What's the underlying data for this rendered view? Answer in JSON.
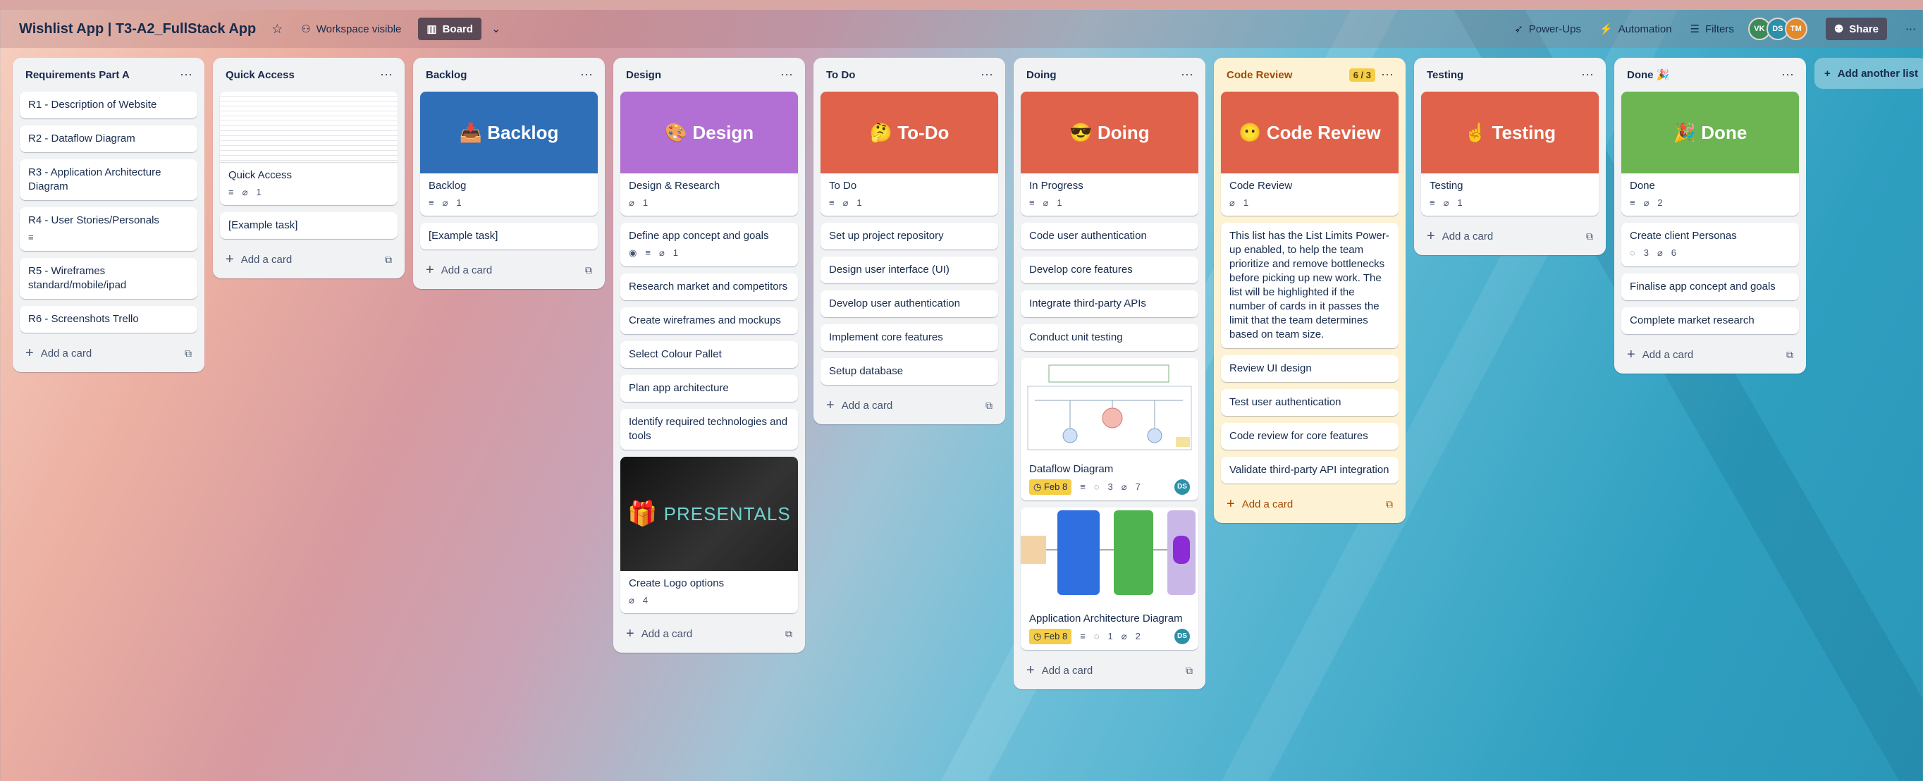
{
  "header": {
    "board_title": "Wishlist App | T3-A2_FullStack App",
    "workspace_label": "Workspace visible",
    "view_label": "Board",
    "power_ups": "Power-Ups",
    "automation": "Automation",
    "filters": "Filters",
    "share": "Share",
    "avatars": [
      {
        "initials": "VK",
        "color": "#3b8a5a"
      },
      {
        "initials": "DS",
        "color": "#2d8fa8"
      },
      {
        "initials": "TM",
        "color": "#e08a2a"
      }
    ]
  },
  "add_list_label": "Add another list",
  "add_card_label": "Add a card",
  "lists": [
    {
      "title": "Requirements Part A",
      "cards": [
        {
          "title": "R1 - Description of Website"
        },
        {
          "title": "R2 - Dataflow Diagram"
        },
        {
          "title": "R3 - Application Architecture Diagram"
        },
        {
          "title": "R4 - User Stories/Personals"
        },
        {
          "title": "R5 - Wireframes standard/mobile/ipad"
        },
        {
          "title": "R6 - Screenshots Trello"
        }
      ]
    },
    {
      "title": "Quick Access",
      "cards": [
        {
          "title": "Quick Access",
          "attachments": "1"
        },
        {
          "title": "[Example task]"
        }
      ]
    },
    {
      "title": "Backlog",
      "cover": "📥 Backlog",
      "cover_color": "#2f6fb8",
      "cards": [
        {
          "title": "Backlog",
          "attachments": "1"
        },
        {
          "title": "[Example task]"
        }
      ]
    },
    {
      "title": "Design",
      "cover": "🎨 Design",
      "cover_color": "#b26fd4",
      "cards": [
        {
          "title": "Design & Research",
          "attachments": "1"
        },
        {
          "title": "Define app concept and goals",
          "attachments": "1"
        },
        {
          "title": "Research market and competitors"
        },
        {
          "title": "Create wireframes and mockups"
        },
        {
          "title": "Select Colour Pallet"
        },
        {
          "title": "Plan app architecture"
        },
        {
          "title": "Identify required technologies and tools"
        },
        {
          "title": "Create Logo options",
          "attachments": "4",
          "logo_text": "PRESENTALS"
        }
      ]
    },
    {
      "title": "To Do",
      "cover": "🤔 To-Do",
      "cover_color": "#e0624a",
      "cards": [
        {
          "title": "To Do",
          "attachments": "1"
        },
        {
          "title": "Set up project repository"
        },
        {
          "title": "Design user interface (UI)"
        },
        {
          "title": "Develop user authentication"
        },
        {
          "title": "Implement core features"
        },
        {
          "title": "Setup database"
        }
      ]
    },
    {
      "title": "Doing",
      "cover": "😎 Doing",
      "cover_color": "#e0624a",
      "cards": [
        {
          "title": "In Progress",
          "attachments": "1"
        },
        {
          "title": "Code user authentication"
        },
        {
          "title": "Develop core features"
        },
        {
          "title": "Integrate third-party APIs"
        },
        {
          "title": "Conduct unit testing"
        },
        {
          "title": "Dataflow Diagram",
          "date": "Feb 8",
          "comments": "3",
          "attachments": "7",
          "member": "DS"
        },
        {
          "title": "Application Architecture Diagram",
          "date": "Feb 8",
          "comments": "1",
          "attachments": "2",
          "member": "DS"
        }
      ]
    },
    {
      "title": "Code Review",
      "limit": "6 / 3",
      "cover": "😶 Code Review",
      "cover_color": "#e0624a",
      "cards": [
        {
          "title": "Code Review",
          "attachments": "1"
        },
        {
          "title": "This list has the List Limits Power-up enabled, to help the team prioritize and remove bottlenecks before picking up new work. The list will be highlighted if the number of cards in it passes the limit that the team determines based on team size."
        },
        {
          "title": "Review UI design"
        },
        {
          "title": "Test user authentication"
        },
        {
          "title": "Code review for core features"
        },
        {
          "title": "Validate third-party API integration"
        }
      ]
    },
    {
      "title": "Testing",
      "cover": "☝ Testing",
      "cover_color": "#e0624a",
      "cards": [
        {
          "title": "Testing",
          "attachments": "1"
        }
      ]
    },
    {
      "title": "Done 🎉",
      "cover": "🎉 Done",
      "cover_color": "#6cb552",
      "cards": [
        {
          "title": "Done",
          "attachments": "2"
        },
        {
          "title": "Create client Personas",
          "comments": "3",
          "attachments": "6"
        },
        {
          "title": "Finalise app concept and goals"
        },
        {
          "title": "Complete market research"
        }
      ]
    }
  ]
}
